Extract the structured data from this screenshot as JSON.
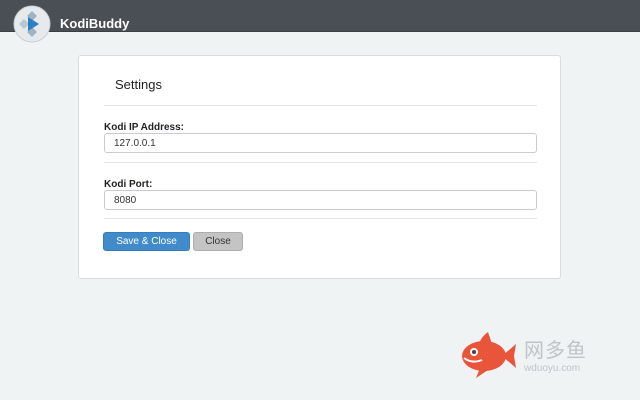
{
  "header": {
    "app_name": "KodiBuddy",
    "logo_icon": "kodi-play-icon",
    "background": "#4a4f56"
  },
  "settings": {
    "title": "Settings",
    "ip_label": "Kodi IP Address:",
    "ip_value": "127.0.0.1",
    "port_label": "Kodi Port:",
    "port_value": "8080",
    "save_label": "Save & Close",
    "close_label": "Close"
  },
  "colors": {
    "primary_button": "#428bca",
    "secondary_button": "#c4c4c4",
    "page_background": "#f0f3f4"
  },
  "watermark": {
    "icon": "fish-logo-icon",
    "text": "网多鱼",
    "url": "wduoyu.com",
    "color": "#e9553b"
  }
}
